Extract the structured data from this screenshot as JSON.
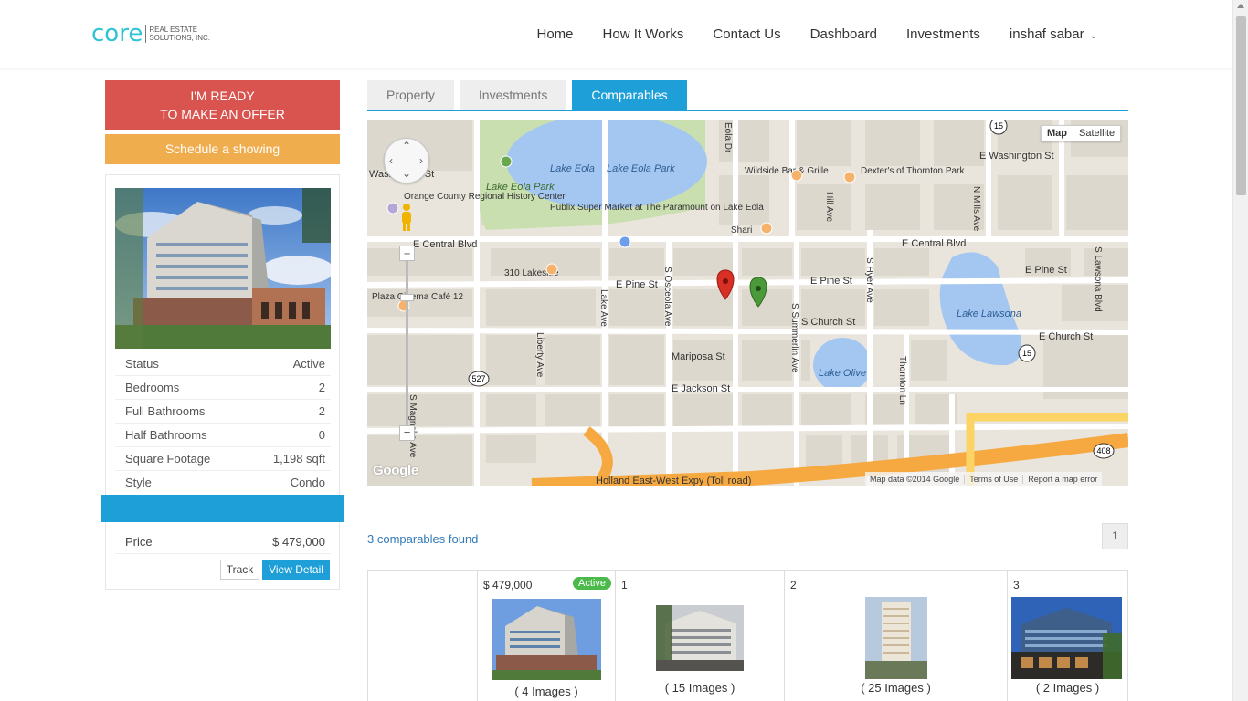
{
  "header": {
    "logo_main": "core",
    "logo_tag": "REAL ESTATE SOLUTIONS, INC.",
    "nav": [
      "Home",
      "How It Works",
      "Contact Us",
      "Dashboard",
      "Investments"
    ],
    "user": "inshaf sabar"
  },
  "sidebar": {
    "offer_line1": "I'M READY",
    "offer_line2": "TO MAKE AN OFFER",
    "showing_label": "Schedule a showing",
    "details": [
      {
        "k": "Status",
        "v": "Active"
      },
      {
        "k": "Bedrooms",
        "v": "2"
      },
      {
        "k": "Full Bathrooms",
        "v": "2"
      },
      {
        "k": "Half Bathrooms",
        "v": "0"
      },
      {
        "k": "Square Footage",
        "v": "1,198 sqft"
      },
      {
        "k": "Style",
        "v": "Condo"
      }
    ],
    "price_label": "Price",
    "price_value": "$ 479,000",
    "track_label": "Track",
    "view_label": "View Detail"
  },
  "tabs": [
    "Property",
    "Investments",
    "Comparables"
  ],
  "map": {
    "type_map": "Map",
    "type_satellite": "Satellite",
    "attrib_data": "Map data ©2014 Google",
    "attrib_terms": "Terms of Use",
    "attrib_report": "Report a map error",
    "google": "Google",
    "labels": {
      "lake_eola": "Lake Eola",
      "lake_eola_park": "Lake Eola Park",
      "lake_eola_park2": "Lake Eola Park",
      "publix": "Publix Super Market at The Paramount on Lake Eola",
      "wildside": "Wildside Bar & Grille",
      "dexters": "Dexter's of Thornton Park",
      "e_washington": "E Washington St",
      "orange_county": "Orange County Regional History Center",
      "washington_st": "Washington St",
      "e_central": "E Central Blvd",
      "e_central2": "E Central Blvd",
      "lakeside": "310 Lakeside",
      "e_pine": "E Pine St",
      "e_pine2": "E Pine St",
      "e_pine3": "E Pine St",
      "plaza": "Plaza Cinema Café 12",
      "lake_lawsona": "Lake Lawsona",
      "e_church": "S Church St",
      "e_church2": "E Church St",
      "mariposa": "Mariposa St",
      "lake_olive": "Lake Olive",
      "jackson": "E Jackson St",
      "holland": "Holland East-West Expy (Toll road)",
      "shari": "Shari",
      "hill_ave": "Hill Ave",
      "n_mills": "N Mills Ave",
      "s_hyer": "S Hyer Ave",
      "s_lawsona": "S Lawsona Blvd",
      "thornton": "Thornton Ln",
      "summerlin": "S Summerlin Ave",
      "osceola": "S Osceola Ave",
      "lake_ave": "Lake Ave",
      "liberty": "Liberty Ave",
      "magnolia": "S Magnolia Ave",
      "eola_dr": "Eola Dr",
      "route_15": "15",
      "route_15b": "15",
      "route_527": "527",
      "route_408": "408"
    }
  },
  "results": {
    "count_text": "3 comparables found",
    "page": "1",
    "columns": [
      {
        "head": "",
        "caption": ""
      },
      {
        "head": "$ 479,000",
        "badge": "Active",
        "caption": "( 4 Images )"
      },
      {
        "head": "1",
        "caption": "( 15 Images )"
      },
      {
        "head": "2",
        "caption": "( 25 Images )"
      },
      {
        "head": "3",
        "caption": "( 2 Images )"
      }
    ]
  },
  "colors": {
    "accent": "#1e9fd8",
    "offer": "#d9534f",
    "showing": "#f0ad4e",
    "logo": "#2fc4d3",
    "badge": "#4cb94b"
  }
}
